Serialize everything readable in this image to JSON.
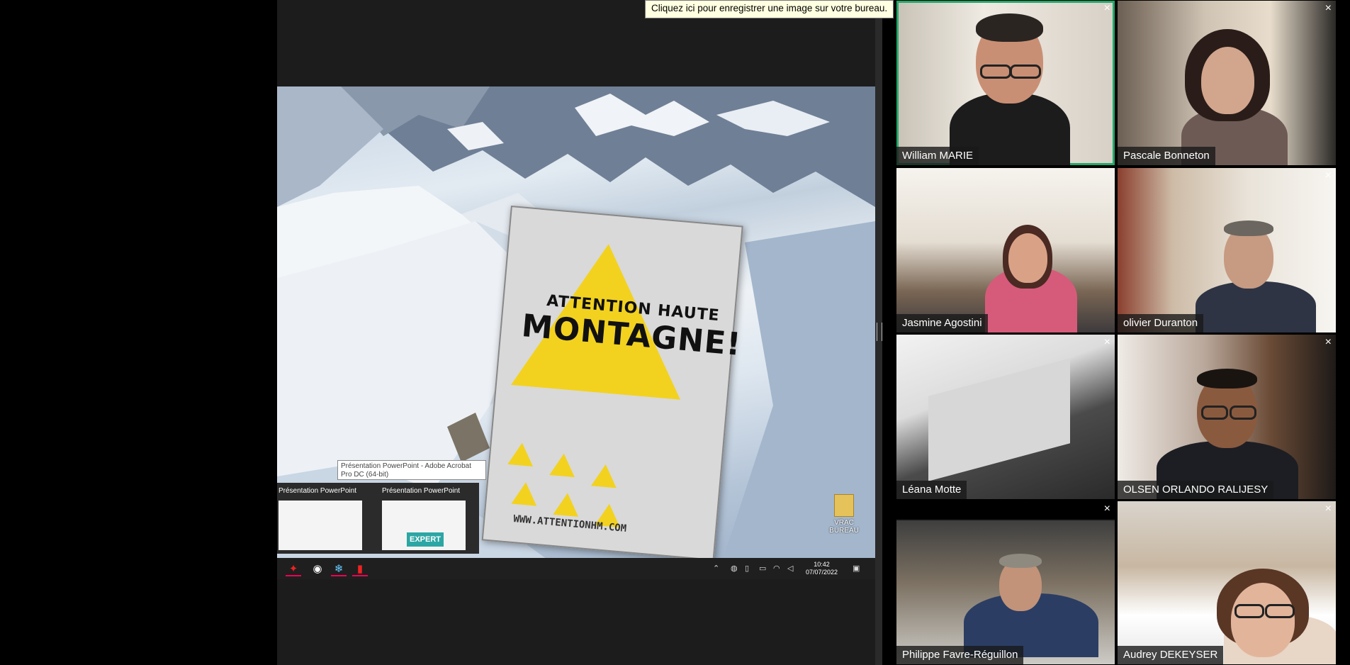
{
  "tooltip": "Cliquez ici pour enregistrer une image sur votre bureau.",
  "shared_screen": {
    "sign": {
      "line1": "ATTENTION HAUTE",
      "line2": "MONTAGNE!",
      "url": "WWW.ATTENTIONHM.COM"
    },
    "desktop_icon_label": "VRAC BUREAU",
    "taskbar_tooltip": "Présentation PowerPoint - Adobe Acrobat Pro DC (64-bit)",
    "thumbnails": [
      {
        "title": "Présentation PowerPoint"
      },
      {
        "title": "Présentation PowerPoint",
        "badge": "EXPERT"
      }
    ],
    "taskbar": {
      "icons": [
        "acrobat-icon",
        "chrome-icon",
        "snowflake-icon",
        "acrobat-pdf-icon"
      ],
      "time": "10:42",
      "date": "07/07/2022"
    }
  },
  "participants": [
    {
      "name": "William MARIE",
      "active": true
    },
    {
      "name": "Pascale Bonneton"
    },
    {
      "name": "Jasmine Agostini"
    },
    {
      "name": "olivier Duranton"
    },
    {
      "name": "Léana Motte"
    },
    {
      "name": "OLSEN ORLANDO RALIJESY"
    },
    {
      "name": "Philippe Favre-Réguillon"
    },
    {
      "name": "Audrey DEKEYSER"
    }
  ],
  "colors": {
    "active_speaker_border": "#23a86a",
    "tooltip_bg": "#ffffe1",
    "sign_yellow": "#f2d21f"
  }
}
